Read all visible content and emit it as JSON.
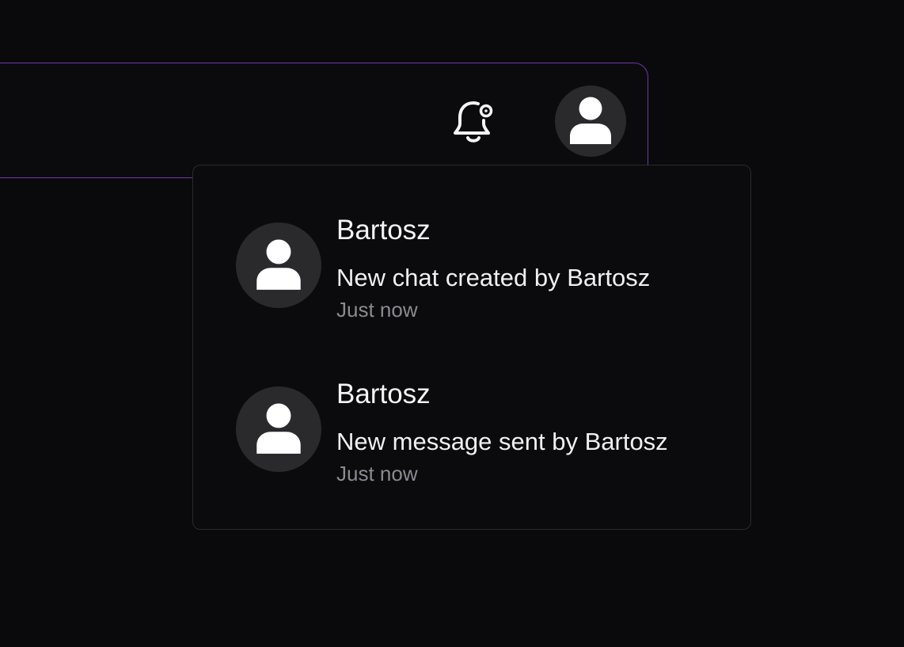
{
  "header": {
    "notifications_icon": "bell-settings-icon",
    "account_icon": "user-icon"
  },
  "notifications": [
    {
      "icon": "user-icon",
      "name": "Bartosz",
      "message": "New chat created by Bartosz",
      "time": "Just now"
    },
    {
      "icon": "user-icon",
      "name": "Bartosz",
      "message": "New message sent by Bartosz",
      "time": "Just now"
    }
  ],
  "colors": {
    "background": "#0a0a0c",
    "accent_border": "#6b3aa6",
    "avatar_bg": "#2a2a2d",
    "muted_text": "#8a8a90"
  }
}
